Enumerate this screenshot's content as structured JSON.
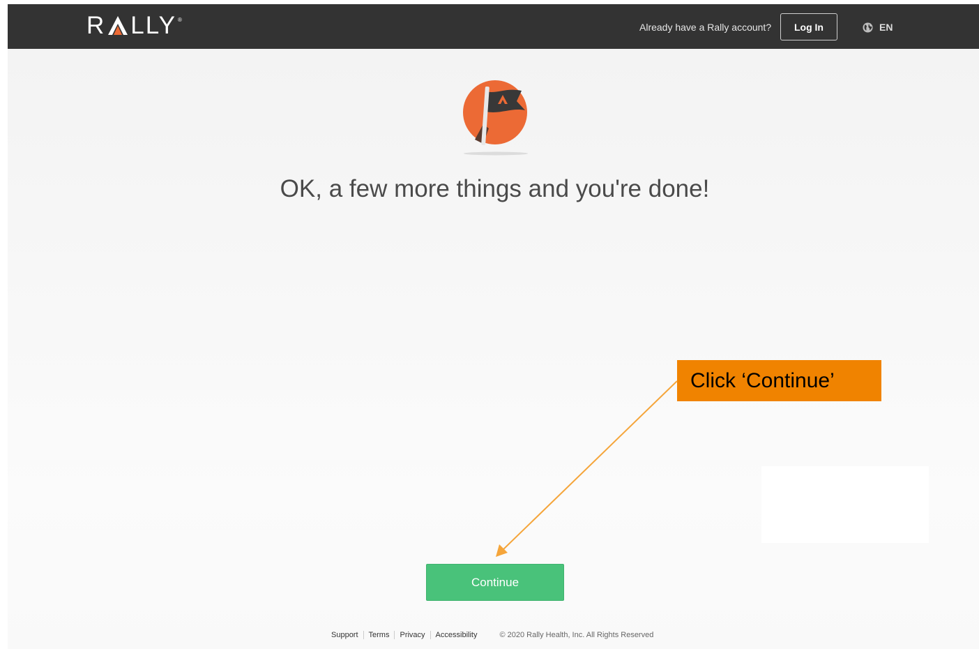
{
  "header": {
    "logo_letters_left": "R",
    "logo_letters_right": "LLY",
    "already_text": "Already have a Rally account?",
    "login_label": "Log In",
    "language_label": "EN"
  },
  "main": {
    "headline": "OK, a few more things and you're done!",
    "continue_label": "Continue"
  },
  "footer": {
    "links": [
      "Support",
      "Terms",
      "Privacy",
      "Accessibility"
    ],
    "copyright": "© 2020 Rally Health, Inc. All Rights Reserved"
  },
  "annotation": {
    "callout_text": "Click ‘Continue’",
    "callout_color": "#f08300",
    "arrow_color": "#f5a53a"
  },
  "colors": {
    "topbar": "#333333",
    "brand_orange": "#ec6a35",
    "continue_green": "#49c27a"
  },
  "icons": {
    "hero": "flag-icon",
    "language": "globe-icon"
  }
}
